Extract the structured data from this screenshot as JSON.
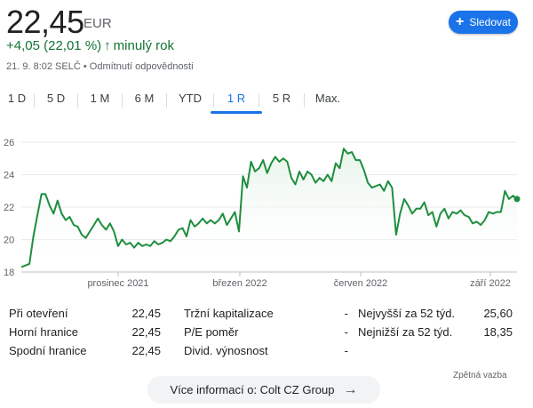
{
  "quote": {
    "price": "22,45",
    "currency": "EUR",
    "change": "+4,05 (22,01 %)",
    "change_arrow": "↑",
    "period": "minulý rok",
    "timestamp": "21. 9. 8:02 SELČ",
    "disclaimer": "Odmítnutí odpovědnosti"
  },
  "follow_button": {
    "label": "Sledovat",
    "icon": "plus-icon"
  },
  "tabs": [
    {
      "label": "1 D",
      "active": false
    },
    {
      "label": "5 D",
      "active": false
    },
    {
      "label": "1 M",
      "active": false
    },
    {
      "label": "6 M",
      "active": false
    },
    {
      "label": "YTD",
      "active": false
    },
    {
      "label": "1 R",
      "active": true
    },
    {
      "label": "5 R",
      "active": false
    },
    {
      "label": "Max.",
      "active": false
    }
  ],
  "colors": {
    "accent": "#1a73e8",
    "positive": "#137333",
    "line": "#1e8e3e"
  },
  "chart_data": {
    "type": "area",
    "ylim": [
      18,
      26
    ],
    "y_ticks": [
      18,
      20,
      22,
      24,
      26
    ],
    "x_tick_labels": [
      "prosinec 2021",
      "březen 2022",
      "červen 2022",
      "září 2022"
    ],
    "grid": true,
    "values": [
      18.3,
      18.4,
      18.5,
      20.2,
      21.5,
      22.8,
      22.8,
      22.1,
      21.6,
      22.4,
      21.6,
      21.2,
      21.4,
      20.9,
      20.8,
      20.3,
      20.1,
      20.5,
      20.9,
      21.3,
      20.9,
      20.6,
      21.0,
      20.5,
      19.6,
      20.0,
      19.7,
      19.8,
      19.5,
      19.8,
      19.6,
      19.7,
      19.6,
      19.9,
      19.7,
      19.8,
      20.0,
      19.9,
      20.2,
      20.6,
      20.7,
      20.2,
      21.2,
      20.8,
      21.0,
      21.3,
      21.0,
      21.2,
      21.0,
      21.2,
      21.6,
      20.9,
      21.3,
      21.7,
      20.5,
      23.9,
      23.2,
      24.8,
      24.2,
      24.4,
      24.9,
      24.1,
      24.7,
      25.1,
      24.8,
      25.0,
      24.8,
      23.8,
      23.4,
      24.2,
      23.7,
      24.2,
      24.0,
      23.5,
      23.8,
      23.6,
      24.0,
      23.6,
      24.7,
      24.4,
      25.6,
      25.3,
      25.4,
      24.9,
      24.9,
      24.3,
      23.5,
      23.2,
      23.3,
      23.4,
      23.0,
      23.6,
      23.2,
      20.3,
      21.6,
      22.5,
      22.1,
      21.6,
      21.9,
      21.9,
      22.3,
      21.5,
      21.7,
      20.8,
      21.6,
      21.9,
      21.3,
      21.7,
      21.6,
      21.8,
      21.5,
      21.4,
      21.0,
      21.1,
      20.9,
      21.2,
      21.7,
      21.6,
      21.7,
      21.7,
      23.0,
      22.5,
      22.7,
      22.5
    ]
  },
  "stats": [
    {
      "label": "Při otevření",
      "value": "22,45"
    },
    {
      "label": "Horní hranice",
      "value": "22,45"
    },
    {
      "label": "Spodní hranice",
      "value": "22,45"
    },
    {
      "label": "Tržní kapitalizace",
      "value": "-"
    },
    {
      "label": "P/E poměr",
      "value": "-"
    },
    {
      "label": "Divid. výnosnost",
      "value": "-"
    },
    {
      "label": "Nejvyšší za 52 týd.",
      "value": "25,60"
    },
    {
      "label": "Nejnižší za 52 týd.",
      "value": "18,35"
    }
  ],
  "feedback_label": "Zpětná vazba",
  "more_info_label": "Více informací o: Colt CZ Group",
  "more_info_icon": "arrow-right-icon"
}
